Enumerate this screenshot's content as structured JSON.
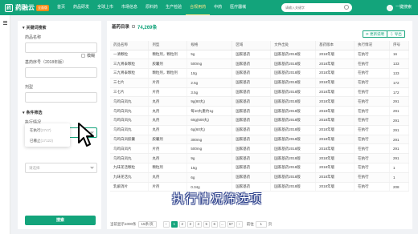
{
  "brand": {
    "logo_glyph": "药",
    "name": "药融云",
    "badge": "全面版"
  },
  "nav": [
    {
      "label": "首页"
    },
    {
      "label": "药品研发"
    },
    {
      "label": "全球上市"
    },
    {
      "label": "市场信息"
    },
    {
      "label": "原料药"
    },
    {
      "label": "生产检验"
    },
    {
      "label": "合规用药"
    },
    {
      "label": "中药"
    },
    {
      "label": "医疗器械"
    }
  ],
  "nav_active_index": 6,
  "search": {
    "placeholder": "请输入关键字"
  },
  "user": {
    "label": "一键搜索"
  },
  "filter": {
    "section1": "关键词搜索",
    "name_label": "药品名称",
    "fuzzy_label": "模糊",
    "ref_label": "基药序号（2018年版）",
    "dosage_label": "剂型",
    "section2": "条件筛选",
    "exec_label": "执行情况",
    "placeholder": "请选择",
    "options": [
      {
        "label": "在执行",
        "count": "(2747)"
      },
      {
        "label": "已撤止",
        "count": "(17122)"
      }
    ],
    "search_button": "搜索"
  },
  "main": {
    "title": "基药目录",
    "count": "74,269条",
    "btn_update": "更新说明",
    "btn_export": "导出",
    "columns": [
      "药品名称",
      "剂型",
      "规格",
      "区域",
      "文件出处",
      "基药版本",
      "执行情况",
      "序号"
    ],
    "rows": [
      [
        "一清颗粒",
        "颗粒剂，颗粒剂",
        "5g",
        "国家基药",
        "国家基药2018版",
        "2018年版",
        "在执行",
        "16"
      ],
      [
        "三九胃泰颗粒",
        "胶囊剂",
        "500mg",
        "国家基药",
        "国家基药2018版",
        "2018年版",
        "在执行",
        "133"
      ],
      [
        "三九胃泰颗粒",
        "颗粒剂，颗粒剂",
        "10g",
        "国家基药",
        "国家基药2018版",
        "2018年版",
        "在执行",
        "133"
      ],
      [
        "三七片",
        "片剂",
        "2.5g",
        "国家基药",
        "国家基药2018版",
        "2018年版",
        "在执行",
        "172"
      ],
      [
        "三七片",
        "片剂",
        "3.5g",
        "国家基药",
        "国家基药2018版",
        "2018年版",
        "在执行",
        "172"
      ],
      [
        "乌鸡白凤丸",
        "丸剂",
        "9g(80丸)",
        "国家基药",
        "国家基药2018版",
        "2018年版",
        "在执行",
        "291"
      ],
      [
        "乌鸡白凤丸",
        "丸剂",
        "每10丸重约1g",
        "国家基药",
        "国家基药2018版",
        "2018年版",
        "在执行",
        "291"
      ],
      [
        "乌鸡白凤丸",
        "丸剂",
        "60g(600丸)",
        "国家基药",
        "国家基药2018版",
        "2018年版",
        "在执行",
        "291"
      ],
      [
        "乌鸡白凤丸",
        "丸剂",
        "6g(60丸)",
        "国家基药",
        "国家基药2018版",
        "2018年版",
        "在执行",
        "291"
      ],
      [
        "乌鸡白凤胶囊",
        "胶囊剂",
        "300mg",
        "国家基药",
        "国家基药2018版",
        "2018年版",
        "在执行",
        "291"
      ],
      [
        "乌鸡白凤片",
        "片剂",
        "500mg",
        "国家基药",
        "国家基药2018版",
        "2018年版",
        "在执行",
        "291"
      ],
      [
        "乌鸡白凤丸",
        "丸剂",
        "9g",
        "国家基药",
        "国家基药2018版",
        "2018年版",
        "在执行",
        "291"
      ],
      [
        "九味羌活颗粒",
        "颗粒剂",
        "15g",
        "国家基药",
        "国家基药2018版",
        "2018年版",
        "在执行",
        "1"
      ],
      [
        "九味羌活丸",
        "丸剂",
        "6g",
        "国家基药",
        "国家基药2018版",
        "2018年版",
        "在执行",
        "1"
      ],
      [
        "乳癖消片",
        "片剂",
        "0.34g",
        "国家基药",
        "国家基药2018版",
        "2018年版",
        "在执行",
        "208"
      ]
    ],
    "pager": {
      "total": "当前显示1000条",
      "per_page": "15条/页",
      "pages": [
        "1",
        "2",
        "3",
        "4",
        "5",
        "6",
        "...",
        "67"
      ],
      "goto_label": "前往",
      "goto_value": "1",
      "goto_suffix": "页"
    }
  },
  "subtitle": "执行情况筛选项"
}
